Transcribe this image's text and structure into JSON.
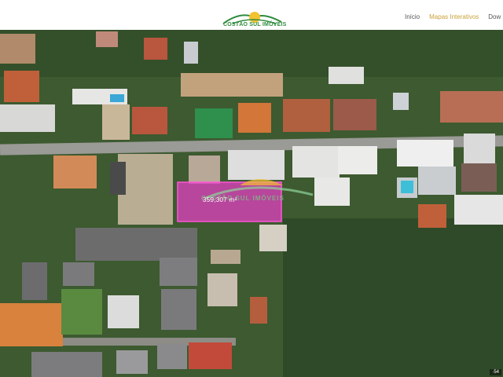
{
  "brand": {
    "name": "COSTÃO SUL IMÓVEIS",
    "primary_color": "#2e8b3d",
    "sun_color": "#f2c230"
  },
  "nav": {
    "items": [
      "Início",
      "Mapas Interativos",
      "Dow"
    ],
    "active_index": 1,
    "active_color": "#c9a23a"
  },
  "map": {
    "lot_area_label": "359,307 m²",
    "lot_highlight_color": "#e040c0",
    "scale_text": "·54",
    "watermark": "COSTÃO SUL IMÓVEIS"
  }
}
